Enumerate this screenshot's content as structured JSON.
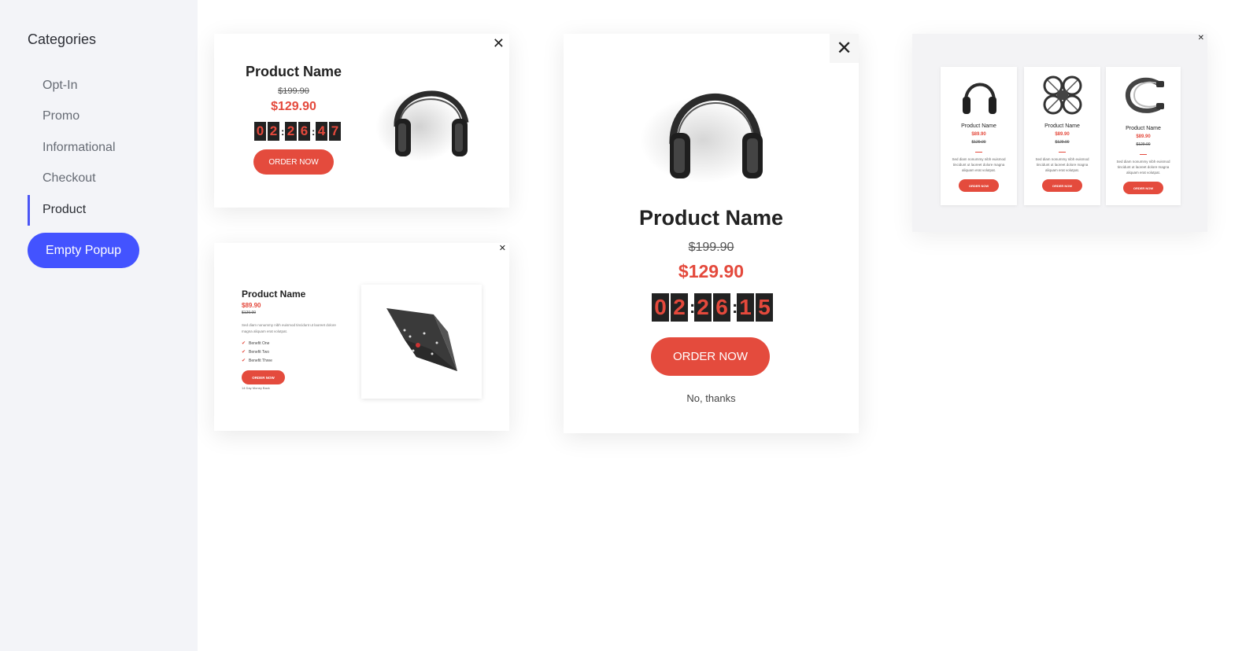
{
  "sidebar": {
    "heading": "Categories",
    "items": [
      {
        "label": "Opt-In"
      },
      {
        "label": "Promo"
      },
      {
        "label": "Informational"
      },
      {
        "label": "Checkout"
      },
      {
        "label": "Product"
      }
    ],
    "active_item": "Product",
    "empty_popup_label": "Empty Popup"
  },
  "card1": {
    "title": "Product Name",
    "old_price": "$199.90",
    "new_price": "$129.90",
    "timer": [
      "0",
      "2",
      "2",
      "6",
      "4",
      "7"
    ],
    "cta": "ORDER NOW",
    "close": "✕"
  },
  "card2": {
    "title": "Product Name",
    "price": "$89.90",
    "old_price": "$129.00",
    "description": "Sed diam nonummy nibh euismod tincidunt ut laoreet dolore magna aliquam erat volutpat.",
    "benefits": [
      "Benefit One",
      "Benefit Two",
      "Benefit Three"
    ],
    "cta": "ORDER NOW",
    "guarantee": "14 Day Money Back",
    "close": "✕"
  },
  "card3": {
    "title": "Product Name",
    "old_price": "$199.90",
    "new_price": "$129.90",
    "timer": [
      "0",
      "2",
      "2",
      "6",
      "1",
      "5"
    ],
    "cta": "ORDER NOW",
    "decline": "No, thanks",
    "close": "✕"
  },
  "card4": {
    "close": "✕",
    "products": [
      {
        "name": "Product Name",
        "price": "$89.90",
        "old_price": "$129.00",
        "description": "Sed diam nonummy nibh euismod tincidunt ut laoreet dolore magna aliquam erat volutpat.",
        "cta": "ORDER NOW"
      },
      {
        "name": "Product Name",
        "price": "$89.90",
        "old_price": "$129.00",
        "description": "Sed diam nonummy nibh euismod tincidunt ut laoreet dolore magna aliquam erat volutpat.",
        "cta": "ORDER NOW"
      },
      {
        "name": "Product Name",
        "price": "$89.90",
        "old_price": "$129.00",
        "description": "Sed diam nonummy nibh euismod tincidunt ut laoreet dolore magna aliquam erat volutpat.",
        "cta": "ORDER NOW"
      }
    ]
  },
  "colors": {
    "accent_blue": "#4353ff",
    "price_red": "#e4493c",
    "sidebar_bg": "#f3f4f8"
  }
}
